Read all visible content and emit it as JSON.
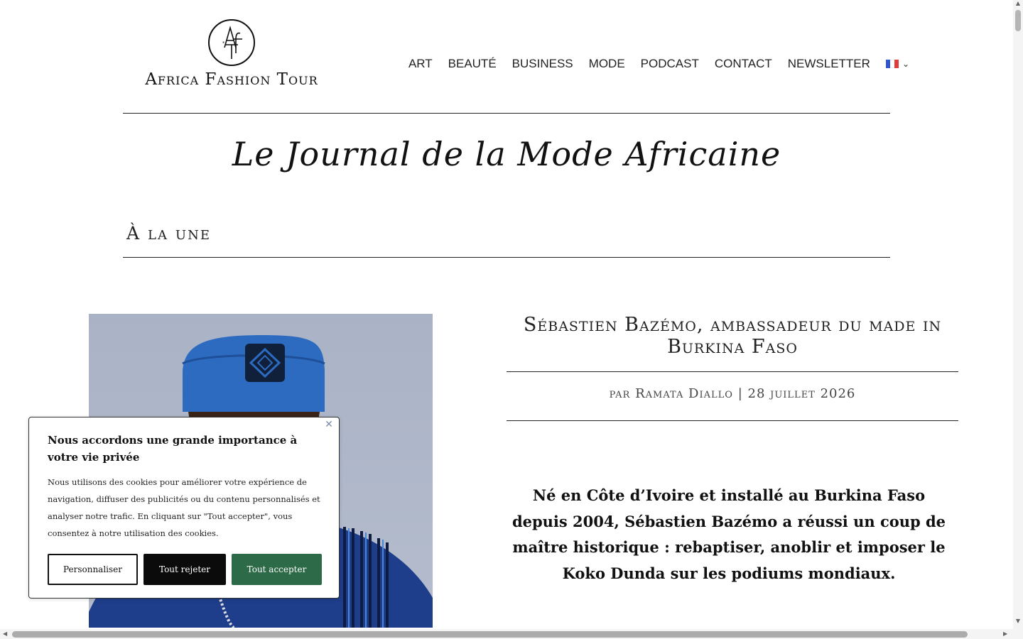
{
  "header": {
    "logo_text": "Africa Fashion Tour",
    "logo_mark": "AfT",
    "nav": [
      "ART",
      "BEAUTÉ",
      "BUSINESS",
      "MODE",
      "PODCAST",
      "CONTACT",
      "NEWSLETTER"
    ],
    "language_flag": "fr-flag-icon",
    "language_colors": [
      "#2f55d4",
      "#ffffff",
      "#e03c3c"
    ]
  },
  "main": {
    "journal_title": "Le Journal de la Mode Africaine",
    "section_heading": "À la une",
    "article": {
      "title": "Sébastien Bazémo, ambassadeur du made in Burkina Faso",
      "meta_prefix": "par",
      "author": "Ramata Diallo",
      "separator": "|",
      "date": "28 juillet 2026",
      "lead": "Né en Côte d’Ivoire et installé au Burkina Faso depuis 2004, Sébastien Bazémo a réussi un coup de maître historique : rebaptiser, anoblir et imposer le Koko Dunda sur les podiums mondiaux."
    }
  },
  "cookie_banner": {
    "title": "Nous accordons une grande importance à votre vie privée",
    "body": "Nous utilisons des cookies pour améliorer votre expérience de navigation, diffuser des publicités ou du contenu personnalisés et analyser notre trafic. En cliquant sur \"Tout accepter\", vous consentez à notre utilisation des cookies.",
    "buttons": {
      "customize": "Personnaliser",
      "reject": "Tout rejeter",
      "accept": "Tout accepter"
    },
    "accept_color": "#2d6a47"
  }
}
